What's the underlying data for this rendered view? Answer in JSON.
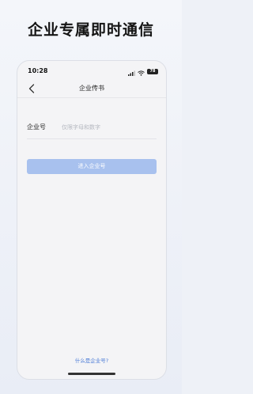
{
  "promo": {
    "headline": "企业专属即时通信"
  },
  "status_bar": {
    "time": "10:28",
    "battery": "78",
    "icons": [
      "signal-icon",
      "wifi-icon",
      "battery-icon"
    ]
  },
  "nav": {
    "back_icon": "chevron-left-icon",
    "title": "企业传书"
  },
  "form": {
    "enterprise_label": "企业号",
    "enterprise_placeholder": "仅限字母和数字",
    "enterprise_value": ""
  },
  "actions": {
    "enter_label": "进入企业号"
  },
  "footer": {
    "help_link": "什么是企业号?"
  },
  "colors": {
    "button_disabled": "#a8c1ee",
    "link": "#4a7ad6",
    "background": "#eef1f7"
  }
}
